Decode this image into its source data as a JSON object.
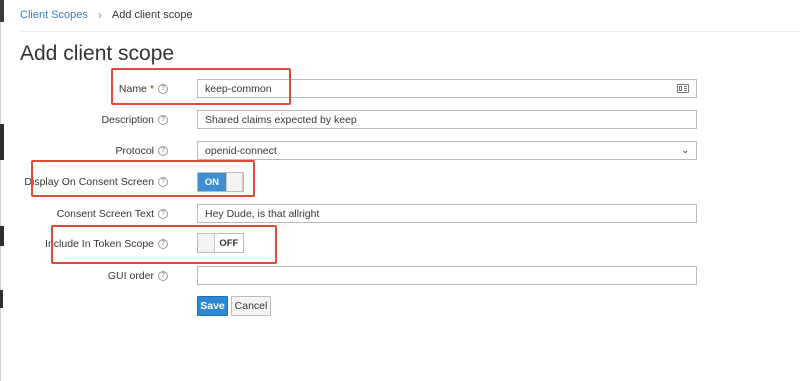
{
  "breadcrumb": {
    "parent": "Client Scopes",
    "separator": "›",
    "current": "Add client scope"
  },
  "page": {
    "title": "Add client scope"
  },
  "form": {
    "name": {
      "label": "Name",
      "required_mark": "*",
      "value": "keep-common"
    },
    "description": {
      "label": "Description",
      "value": "Shared claims expected by keep"
    },
    "protocol": {
      "label": "Protocol",
      "value": "openid-connect"
    },
    "display_on_consent": {
      "label": "Display On Consent Screen",
      "state": "ON"
    },
    "consent_text": {
      "label": "Consent Screen Text",
      "value": "Hey Dude, is that allright"
    },
    "include_in_token_scope": {
      "label": "Include In Token Scope",
      "state": "OFF"
    },
    "gui_order": {
      "label": "GUI order",
      "value": ""
    }
  },
  "actions": {
    "save": "Save",
    "cancel": "Cancel"
  },
  "icons": {
    "help": "question-circle-icon",
    "name_field": "id-card-icon",
    "select": "chevron-down-icon"
  },
  "colors": {
    "accent": "#3d8fd1",
    "highlight": "#e04b3a",
    "link": "#3b7cc2",
    "required": "#c9190b"
  }
}
